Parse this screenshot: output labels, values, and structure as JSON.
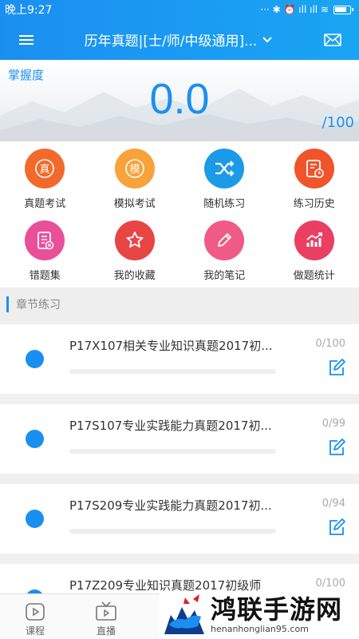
{
  "status_bar": {
    "time": "晚上9:27",
    "indicators": "··· ✱ ⏰ ıll ıll ≋"
  },
  "header": {
    "title": "历年真题|[士/师/中级通用]..."
  },
  "mastery": {
    "label": "掌握度",
    "value": "0.0",
    "total": "/100"
  },
  "grid": [
    {
      "label": "真题考试",
      "glyph": "真",
      "color": "#f26a2b",
      "icon": "real-exam-icon"
    },
    {
      "label": "模拟考试",
      "glyph": "模",
      "color": "#f8a23b",
      "icon": "mock-exam-icon"
    },
    {
      "label": "随机练习",
      "glyph": "⤮",
      "color": "#1b9ae8",
      "icon": "shuffle-icon"
    },
    {
      "label": "练习历史",
      "glyph": "",
      "color": "#f0542a",
      "icon": "history-icon"
    },
    {
      "label": "错题集",
      "glyph": "",
      "color": "#ea4f9a",
      "icon": "wrong-questions-icon"
    },
    {
      "label": "我的收藏",
      "glyph": "☆",
      "color": "#e84545",
      "icon": "star-icon"
    },
    {
      "label": "我的笔记",
      "glyph": "✎",
      "color": "#ef5a86",
      "icon": "pencil-icon"
    },
    {
      "label": "做题统计",
      "glyph": "",
      "color": "#ea3e63",
      "icon": "stats-icon"
    }
  ],
  "section": {
    "title": "章节练习"
  },
  "chapters": [
    {
      "title": "P17X107相关专业知识真题2017初...",
      "count": "0/100",
      "progress": 0
    },
    {
      "title": "P17S107专业实践能力真题2017初...",
      "count": "0/99",
      "progress": 0
    },
    {
      "title": "P17S209专业实践能力真题2017初...",
      "count": "0/94",
      "progress": 0
    },
    {
      "title": "P17Z209专业知识真题2017初级师",
      "count": "0/100",
      "progress": 0
    }
  ],
  "bottom_nav": [
    {
      "label": "课程"
    },
    {
      "label": "直播"
    }
  ],
  "watermark": {
    "main": "鸿联手游网",
    "sub": "henanhonglian95.com"
  },
  "colors": {
    "primary": "#1b8ff1",
    "background": "#f0f0f0"
  }
}
